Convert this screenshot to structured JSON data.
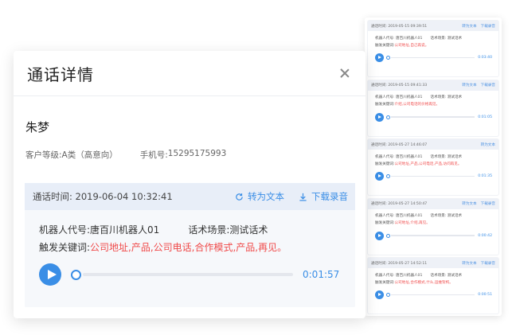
{
  "modal": {
    "title": "通话详情",
    "customer_name": "朱梦",
    "customer_level_label": "客户等级:",
    "customer_level_value": "A类（高意向）",
    "phone_label": "手机号:",
    "phone_value": "15295175993",
    "call": {
      "time_label": "通话时间:",
      "time_value": "2019-06-04 10:32:41",
      "to_text_label": "转为文本",
      "download_label": "下载录音",
      "robot_label": "机器人代号:",
      "robot_value": "唐百川机器人01",
      "scene_label": "话术场景:",
      "scene_value": "测试话术",
      "keywords_label": "触发关键词:",
      "keywords_value": "公司地址,产品,公司电话,合作模式,产品,再见。",
      "duration": "0:01:57"
    }
  },
  "list": {
    "items": [
      {
        "time": "通话时间: 2019-05-15 09:39:51",
        "actions": [
          "转为文本",
          "下载录音"
        ],
        "robot": "机器人代号: 唐百川机器人01",
        "scene": "话术场景: 测试话术",
        "kw_label": "触发关键词:",
        "keywords": "公司地址,自己再说。",
        "duration": "0:03:40"
      },
      {
        "time": "通话时间: 2019-05-15 09:41:33",
        "actions": [
          "转为文本",
          "下载录音"
        ],
        "robot": "机器人代号: 唐百川机器人01",
        "scene": "话术场景: 测试话术",
        "kw_label": "触发关键词:",
        "keywords": "介绍,公司电话的价格再见。",
        "duration": "0:01:05"
      },
      {
        "time": "通话时间: 2019-05-27 14:46:07",
        "actions": [
          "转为文本"
        ],
        "robot": "机器人代号: 唐百川机器人01",
        "scene": "话术场景: 测试话术",
        "kw_label": "触发关键词:",
        "keywords": "公司地址,产品,公司电话,产品,访问再见。",
        "duration": "0:01:35"
      },
      {
        "time": "通话时间: 2019-05-27 14:50:47",
        "actions": [
          "转为文本",
          "下载录音"
        ],
        "robot": "机器人代号: 唐百川机器人01",
        "scene": "话术场景: 测试话术",
        "kw_label": "触发关键词:",
        "keywords": "公司地址,介绍,再见。",
        "duration": "0:00:42"
      },
      {
        "time": "通话时间: 2019-05-27 14:52:11",
        "actions": [
          "转为文本",
          "下载录音"
        ],
        "robot": "机器人代号: 唐百川机器人01",
        "scene": "话术场景: 测试话术",
        "kw_label": "触发关键词:",
        "keywords": "公司地址,合作模式,什么,运维架构。",
        "duration": "0:00:51"
      }
    ]
  },
  "colors": {
    "accent": "#3a8ee6",
    "keyword": "#f04a4a",
    "card_header": "#e8eef8",
    "card_bg": "#f6f8fb"
  }
}
